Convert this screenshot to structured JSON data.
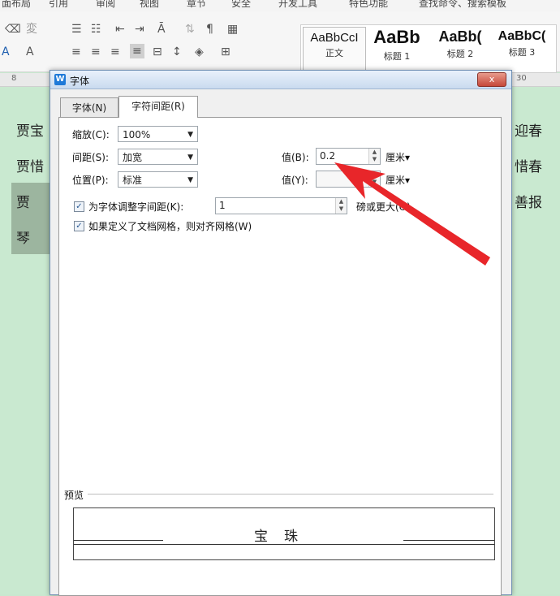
{
  "menu": [
    "面布局",
    "引用",
    "审阅",
    "视图",
    "章节",
    "安全",
    "开发工具",
    "特色功能",
    "查找命令、搜索模板"
  ],
  "styles": [
    {
      "sample": "AaBbCcI",
      "name": "正文"
    },
    {
      "sample": "AaBb",
      "name": "标题 1"
    },
    {
      "sample": "AaBb(",
      "name": "标题 2"
    },
    {
      "sample": "AaBbC(",
      "name": "标题 3"
    }
  ],
  "ruler": {
    "left": "8",
    "right": "30"
  },
  "document": {
    "lines": [
      "贾宝",
      "贾惜",
      "贾  ",
      "琴  "
    ],
    "right_lines": [
      "迎春",
      "惜春",
      "善报"
    ]
  },
  "dialog": {
    "title": "字体",
    "close_label": "x",
    "tabs": [
      {
        "label": "字体(N)",
        "active": false
      },
      {
        "label": "字符间距(R)",
        "active": true
      }
    ],
    "scale_label": "缩放(C):",
    "scale_value": "100%",
    "spacing_label": "间距(S):",
    "spacing_value": "加宽",
    "spacing_amount_label": "值(B):",
    "spacing_amount_value": "0.2",
    "spacing_unit": "厘米",
    "position_label": "位置(P):",
    "position_value": "标准",
    "position_amount_label": "值(Y):",
    "position_amount_value": "",
    "position_unit": "厘米",
    "kerning_label": "为字体调整字间距(K):",
    "kerning_checked": true,
    "kerning_value": "1",
    "kerning_suffix": "磅或更大(O)",
    "grid_label": "如果定义了文档网格，则对齐网格(W)",
    "grid_checked": true,
    "preview_label": "预览",
    "preview_text": "宝珠"
  },
  "arrow_color": "#e8262a"
}
